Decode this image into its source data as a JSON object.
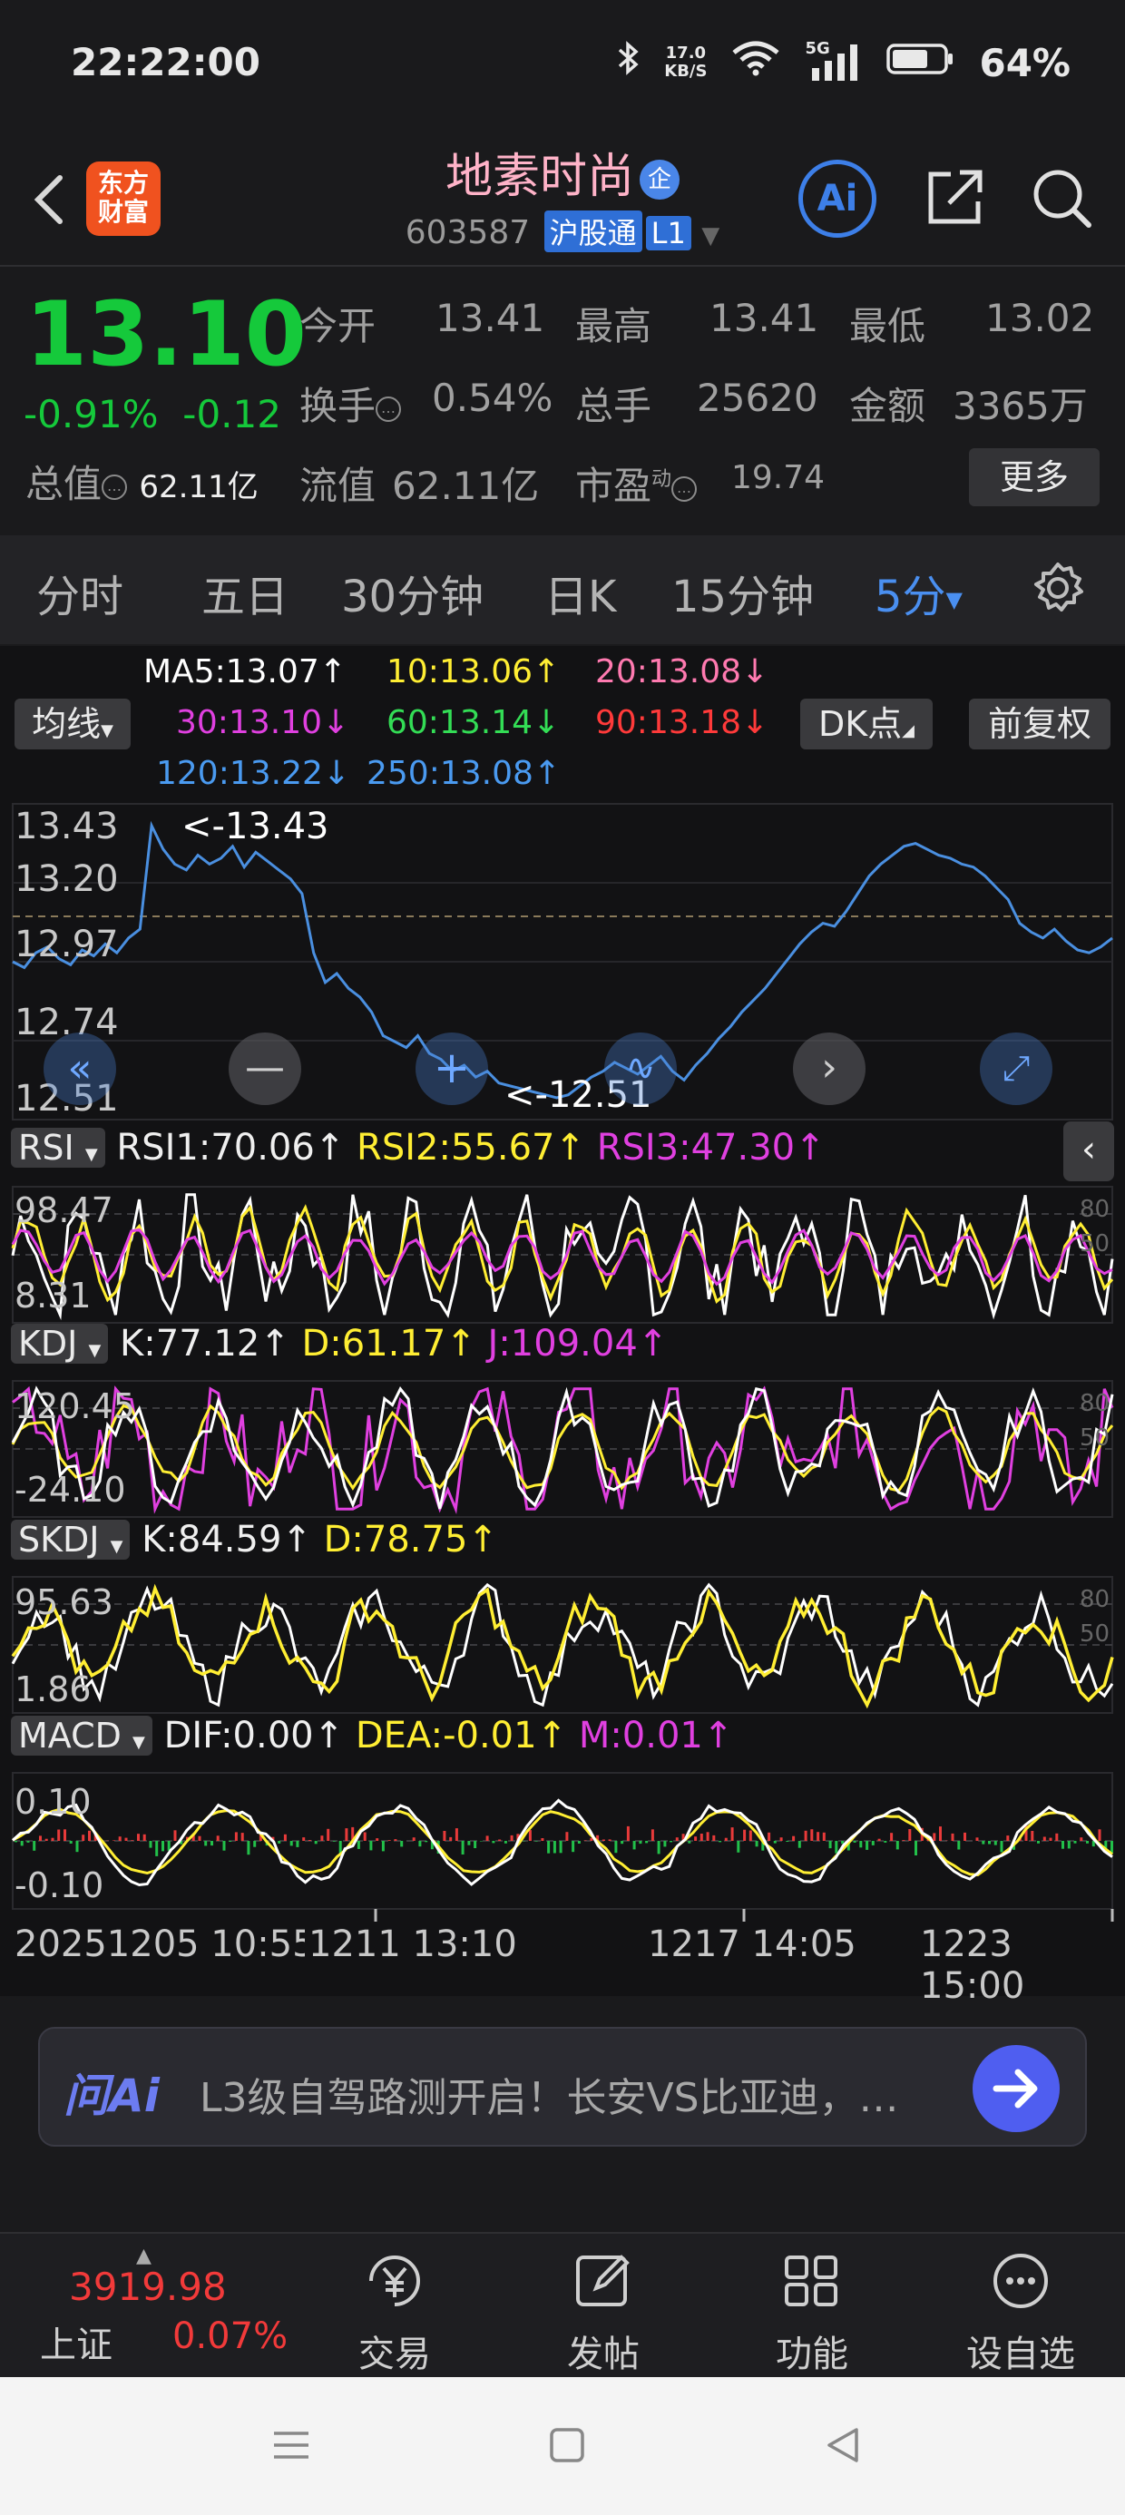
{
  "status": {
    "time": "22:22:00",
    "net_speed": "17.0",
    "net_unit": "KB/S",
    "signal": "5G",
    "battery": "64%"
  },
  "header": {
    "logo_line1": "东方",
    "logo_line2": "财富",
    "title": "地素时尚",
    "title_badge": "企",
    "code": "603587",
    "tag1": "沪股通",
    "tag2": "L1",
    "ai_label": "Ai"
  },
  "quote": {
    "price": "13.10",
    "change_pct": "-0.91%",
    "change": "-0.12",
    "open_label": "今开",
    "open": "13.41",
    "high_label": "最高",
    "high": "13.41",
    "low_label": "最低",
    "low": "13.02",
    "turnover_label": "换手",
    "turnover": "0.54%",
    "volume_label": "总手",
    "volume": "25620",
    "amount_label": "金额",
    "amount": "3365万",
    "mktcap_label": "总值",
    "mktcap": "62.11亿",
    "float_label": "流值",
    "float": "62.11亿",
    "pe_label": "市盈",
    "pe_sup": "动",
    "pe": "19.74",
    "more": "更多"
  },
  "tabs": [
    {
      "label": "分时"
    },
    {
      "label": "五日"
    },
    {
      "label": "30分钟"
    },
    {
      "label": "日K"
    },
    {
      "label": "15分钟"
    },
    {
      "label": "5分",
      "active": true
    }
  ],
  "chart": {
    "ma_selector": "均线",
    "dk": "DK点",
    "adjust": "前复权",
    "ma": [
      {
        "text": "MA5:13.07↑",
        "color": "#ffffff"
      },
      {
        "text": "10:13.06↑",
        "color": "#ffee33"
      },
      {
        "text": "20:13.08↓",
        "color": "#ff7ab0"
      },
      {
        "text": "30:13.10↓",
        "color": "#e040e0"
      },
      {
        "text": "60:13.14↓",
        "color": "#33dd55"
      },
      {
        "text": "90:13.18↓",
        "color": "#ff3a3a"
      },
      {
        "text": "120:13.22↓",
        "color": "#4a9af0"
      },
      {
        "text": "250:13.08↑",
        "color": "#4a9af0"
      }
    ],
    "price_axis": [
      "13.43",
      "13.20",
      "12.97",
      "12.74",
      "12.51"
    ],
    "high_mark": "<-13.43",
    "low_mark": "<-12.51",
    "rsi": {
      "name": "RSI",
      "v1": "RSI1:70.06↑",
      "v2": "RSI2:55.67↑",
      "v3": "RSI3:47.30↑",
      "top": "98.47",
      "bottom": "8.31",
      "r80": "80",
      "r50": "50"
    },
    "kdj": {
      "name": "KDJ",
      "k": "K:77.12↑",
      "d": "D:61.17↑",
      "j": "J:109.04↑",
      "top": "120.45",
      "bottom": "-24.10",
      "r80": "80",
      "r50": "50"
    },
    "skdj": {
      "name": "SKDJ",
      "k": "K:84.59↑",
      "d": "D:78.75↑",
      "top": "95.63",
      "bottom": "1.86",
      "r80": "80",
      "r50": "50"
    },
    "macd": {
      "name": "MACD",
      "dif": "DIF:0.00↑",
      "dea": "DEA:-0.01↑",
      "m": "M:0.01↑",
      "top": "0.10",
      "bottom": "-0.10"
    },
    "dates": [
      "20251205 10:55",
      "1211 13:10",
      "1217 14:05",
      "1223 15:00"
    ]
  },
  "chart_data": {
    "type": "line",
    "ylim": [
      12.51,
      13.43
    ],
    "series": [
      {
        "values": [
          12.97,
          12.95,
          13.0,
          13.02,
          12.98,
          12.96,
          13.01,
          12.99,
          13.03,
          13.0,
          13.05,
          13.08,
          13.43,
          13.35,
          13.3,
          13.28,
          13.33,
          13.3,
          13.32,
          13.36,
          13.29,
          13.34,
          13.31,
          13.28,
          13.25,
          13.2,
          13.0,
          12.9,
          12.93,
          12.88,
          12.85,
          12.8,
          12.72,
          12.7,
          12.68,
          12.72,
          12.66,
          12.64,
          12.6,
          12.62,
          12.58,
          12.6,
          12.56,
          12.55,
          12.54,
          12.53,
          12.52,
          12.51,
          12.52,
          12.55,
          12.58,
          12.6,
          12.63,
          12.61,
          12.59,
          12.62,
          12.65,
          12.6,
          12.57,
          12.62,
          12.66,
          12.71,
          12.75,
          12.8,
          12.84,
          12.88,
          12.93,
          12.98,
          13.03,
          13.07,
          13.1,
          13.09,
          13.14,
          13.2,
          13.26,
          13.3,
          13.33,
          13.36,
          13.37,
          13.35,
          13.33,
          13.32,
          13.3,
          13.29,
          13.26,
          13.22,
          13.18,
          13.1,
          13.07,
          13.05,
          13.08,
          13.04,
          13.01,
          13.0,
          13.02,
          13.05
        ]
      }
    ]
  },
  "ai": {
    "label": "问Ai",
    "text": "L3级自驾路测开启！长安VS比亚迪，…"
  },
  "bottom": {
    "index_value": "3919.98",
    "index_name": "上证",
    "index_change": "0.07%",
    "trade": "交易",
    "post": "发帖",
    "func": "功能",
    "watch": "设自选"
  }
}
